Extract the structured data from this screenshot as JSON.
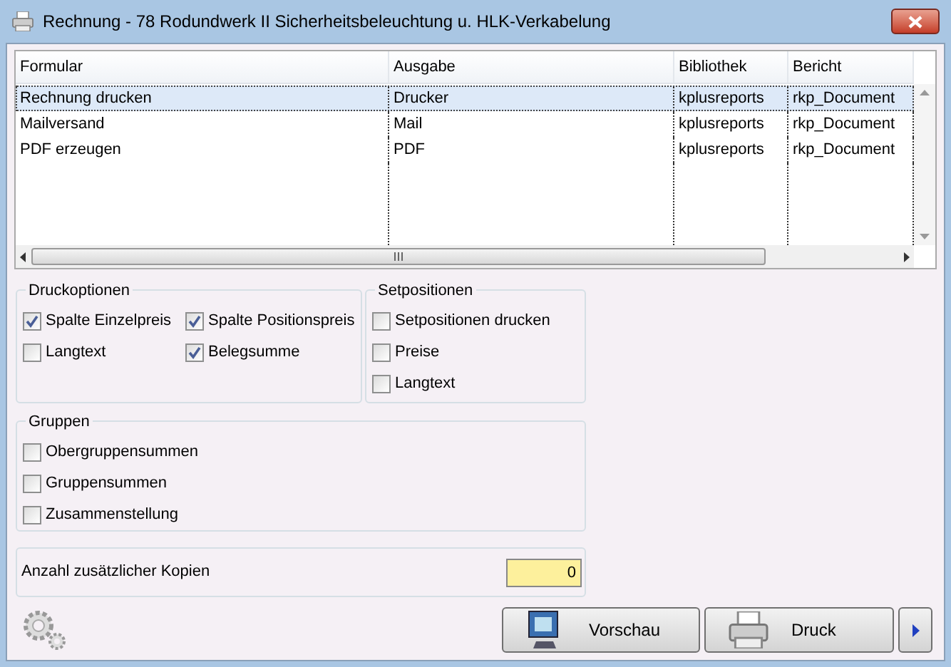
{
  "window": {
    "title": "Rechnung - 78 Rodundwerk II Sicherheitsbeleuchtung u. HLK-Verkabelung"
  },
  "table": {
    "columns": [
      "Formular",
      "Ausgabe",
      "Bibliothek",
      "Bericht"
    ],
    "rows": [
      {
        "cells": [
          "Rechnung drucken",
          "Drucker",
          "kplusreports",
          "rkp_Document"
        ],
        "selected": true
      },
      {
        "cells": [
          "Mailversand",
          "Mail",
          "kplusreports",
          "rkp_Document"
        ],
        "selected": false
      },
      {
        "cells": [
          "PDF erzeugen",
          "PDF",
          "kplusreports",
          "rkp_Document"
        ],
        "selected": false
      }
    ]
  },
  "druckoptionen": {
    "title": "Druckoptionen",
    "options": [
      {
        "label": "Spalte Einzelpreis",
        "checked": true
      },
      {
        "label": "Spalte Positionspreis",
        "checked": true
      },
      {
        "label": "Langtext",
        "checked": false
      },
      {
        "label": "Belegsumme",
        "checked": true
      }
    ]
  },
  "setpositionen": {
    "title": "Setpositionen",
    "options": [
      {
        "label": "Setpositionen drucken",
        "checked": false
      },
      {
        "label": "Preise",
        "checked": false
      },
      {
        "label": "Langtext",
        "checked": false
      }
    ]
  },
  "gruppen": {
    "title": "Gruppen",
    "options": [
      {
        "label": "Obergruppensummen",
        "checked": false
      },
      {
        "label": "Gruppensummen",
        "checked": false
      },
      {
        "label": "Zusammenstellung",
        "checked": false
      }
    ]
  },
  "kopien": {
    "label": "Anzahl zusätzlicher Kopien",
    "value": "0"
  },
  "buttons": [
    {
      "label": "Vorschau",
      "kind": "preview"
    },
    {
      "label": "Druck",
      "kind": "print"
    }
  ]
}
